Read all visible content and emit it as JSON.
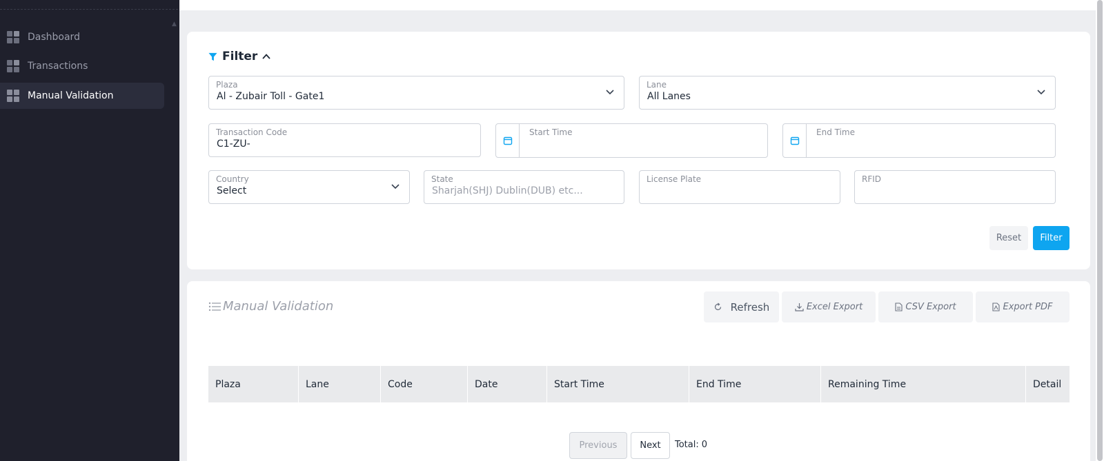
{
  "sidebar": {
    "items": [
      {
        "label": "Dashboard",
        "active": false
      },
      {
        "label": "Transactions",
        "active": false
      },
      {
        "label": "Manual Validation",
        "active": true
      }
    ]
  },
  "filter": {
    "title": "Filter",
    "plaza": {
      "label": "Plaza",
      "value": "Al - Zubair Toll - Gate1"
    },
    "lane": {
      "label": "Lane",
      "value": "All Lanes"
    },
    "transaction_code": {
      "label": "Transaction Code",
      "value": "C1-ZU-"
    },
    "start_time": {
      "label": "Start Time",
      "value": ""
    },
    "end_time": {
      "label": "End Time",
      "value": ""
    },
    "country": {
      "label": "Country",
      "value": "Select"
    },
    "state": {
      "label": "State",
      "placeholder": "Sharjah(SHJ) Dublin(DUB) etc..."
    },
    "license_plate": {
      "label": "License Plate",
      "value": ""
    },
    "rfid": {
      "label": "RFID",
      "value": ""
    },
    "reset_label": "Reset",
    "filter_label": "Filter"
  },
  "list": {
    "title": "Manual Validation",
    "refresh_label": "Refresh",
    "excel_label": "Excel Export",
    "csv_label": "CSV Export",
    "pdf_label": "Export PDF",
    "columns": [
      "Plaza",
      "Lane",
      "Code",
      "Date",
      "Start Time",
      "End Time",
      "Remaining Time",
      "Detail"
    ],
    "rows": []
  },
  "pagination": {
    "previous_label": "Previous",
    "next_label": "Next",
    "total_label": "Total:",
    "total_value": "0"
  },
  "colors": {
    "sidebar_bg": "#1f202c",
    "accent": "#0ea5f0",
    "page_bg": "#edeef1"
  },
  "icons": [
    "grid-icon",
    "funnel-icon",
    "chevron-up-icon",
    "chevron-down-icon",
    "calendar-icon",
    "list-icon",
    "refresh-icon",
    "download-icon",
    "file-icon",
    "pdf-file-icon"
  ]
}
